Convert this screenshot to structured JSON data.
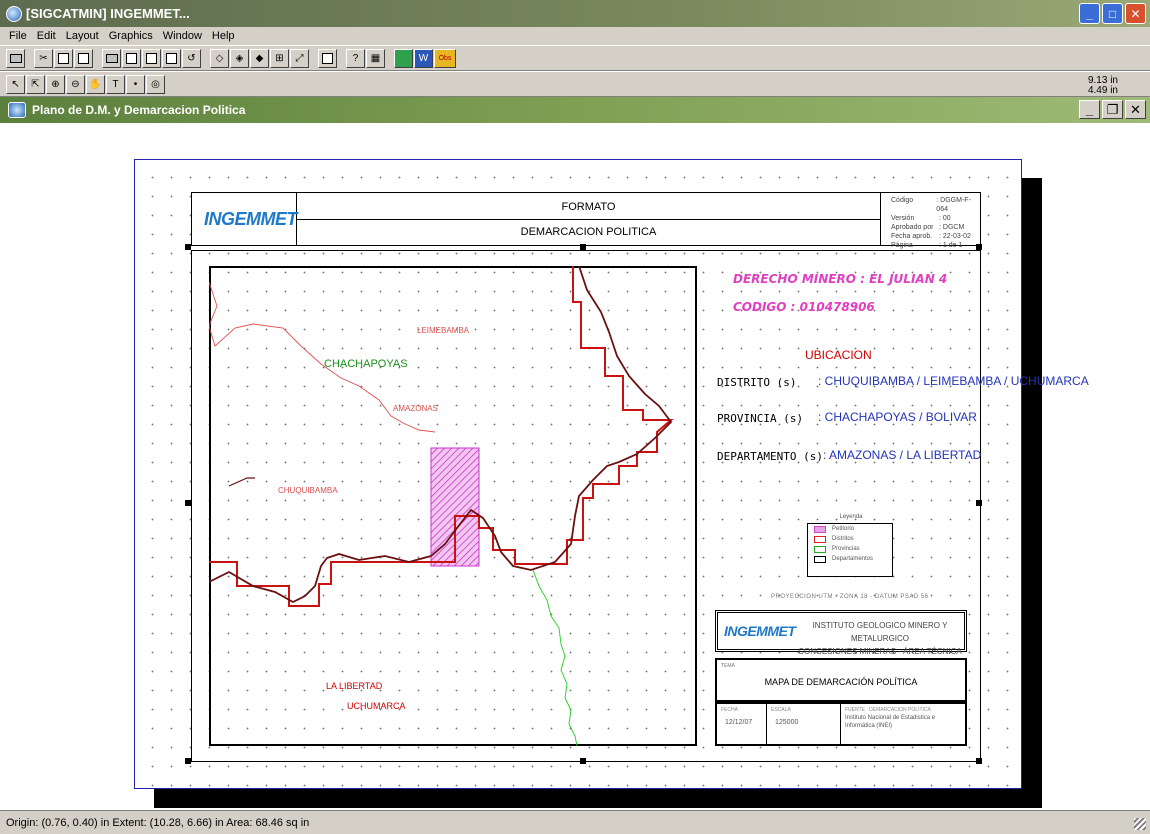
{
  "window": {
    "title": "[SIGCATMIN] INGEMMET..."
  },
  "menu": {
    "items": [
      "File",
      "Edit",
      "Layout",
      "Graphics",
      "Window",
      "Help"
    ]
  },
  "toolbar": {
    "obs_label": "Obs",
    "w_label": "W"
  },
  "dims": {
    "width": "9.13 in",
    "height": "4.49 in"
  },
  "child": {
    "title": "Plano de D.M. y Demarcacion Politica"
  },
  "header": {
    "formato": "FORMATO",
    "demarcacion": "DEMARCACION POLITICA",
    "logo": "INGEMMET",
    "meta": [
      {
        "k": "Código",
        "v": ": DGGM-F-064"
      },
      {
        "k": "Versión",
        "v": ": 00"
      },
      {
        "k": "Aprobado por",
        "v": ": DGCM"
      },
      {
        "k": "Fecha aprob.",
        "v": ": 22-03-02"
      },
      {
        "k": "Página",
        "v": ": 1 de 1"
      }
    ]
  },
  "map": {
    "places": {
      "leimebamba": "LEIMEBAMBA",
      "chachapoyas": "CHACHAPOYAS",
      "amazonas": "AMAZONAS",
      "chuquibamba": "CHUQUIBAMBA",
      "la_libertad": "LA LIBERTAD",
      "uchumarca": "UCHUMARCA"
    }
  },
  "info": {
    "derecho": "DERECHO MINERO : EL JULIAN 4",
    "codigo": "CODIGO   : 010478906",
    "ubicacion": "UBICACION",
    "distrito_label": "DISTRITO  (s)",
    "distrito_value": ": CHUQUIBAMBA / LEIMEBAMBA / UCHUMARCA",
    "provincia_label": "PROVINCIA  (s)",
    "provincia_value": ": CHACHAPOYAS / BOLIVAR",
    "departamento_label": "DEPARTAMENTO (s)",
    "departamento_value": ": AMAZONAS / LA LIBERTAD"
  },
  "legend": {
    "title": "Leyenda",
    "items": [
      {
        "label": "Petitorio",
        "color": "#cc44cc"
      },
      {
        "label": "Distritos",
        "color": "#dd2222"
      },
      {
        "label": "Provincias",
        "color": "#22aa22"
      },
      {
        "label": "Departamentos",
        "color": "#000000"
      }
    ]
  },
  "projection": "PROYECCION UTM - ZONA 18 - DATUM PSAD 56",
  "institute": {
    "line1": "INSTITUTO GEOLOGICO MINERO Y METALURGICO",
    "line2": "CONCESIONES MINERAS - ÁREA TÉCNICA"
  },
  "mapa": {
    "label": "TEMA",
    "title": "MAPA DE DEMARCACIÓN POLÍTICA"
  },
  "meta_box": {
    "fecha_label": "FECHA",
    "fecha": "12/12/07",
    "escala_label": "ESCALA",
    "escala": "125000",
    "fuente_label": "FUENTE : DEMARCACION POLITICA",
    "fuente": "Instituto Nacional de Estadistica e Informática (INEI)"
  },
  "status": {
    "text": "Origin: (0.76, 0.40) in  Extent: (10.28, 6.66) in  Area: 68.46 sq in"
  }
}
